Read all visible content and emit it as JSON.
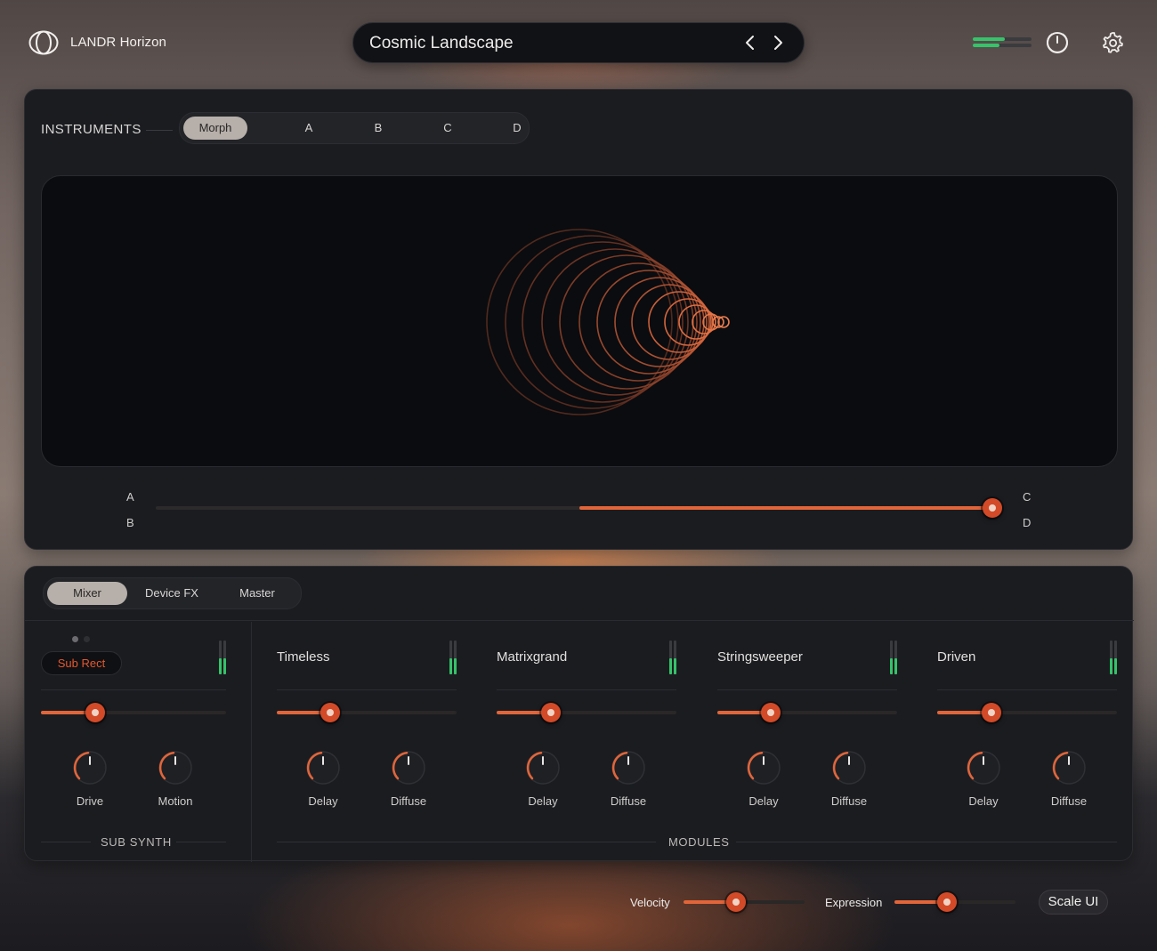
{
  "app": {
    "name": "LANDR Horizon"
  },
  "preset": {
    "name": "Cosmic Landscape"
  },
  "instruments": {
    "label": "INSTRUMENTS",
    "tabs": [
      "Morph",
      "A",
      "B",
      "C",
      "D"
    ],
    "active_tab": "Morph"
  },
  "morph": {
    "corner_labels": {
      "top_left": "A",
      "bottom_left": "B",
      "top_right": "C",
      "bottom_right": "D"
    },
    "position": 1.0
  },
  "mixer_tabs": {
    "items": [
      "Mixer",
      "Device FX",
      "Master"
    ],
    "active": "Mixer"
  },
  "sub_synth": {
    "source_label": "Sub Rect",
    "level": 0.29,
    "knobs": [
      {
        "label": "Drive",
        "value": 0.4
      },
      {
        "label": "Motion",
        "value": 0.45
      }
    ],
    "section_label": "SUB SYNTH"
  },
  "modules": {
    "section_label": "MODULES",
    "channels": [
      {
        "name": "Timeless",
        "level": 0.29,
        "knobs": [
          {
            "label": "Delay",
            "value": 0.4
          },
          {
            "label": "Diffuse",
            "value": 0.45
          }
        ]
      },
      {
        "name": "Matrixgrand",
        "level": 0.29,
        "knobs": [
          {
            "label": "Delay",
            "value": 0.4
          },
          {
            "label": "Diffuse",
            "value": 0.45
          }
        ]
      },
      {
        "name": "Stringsweeper",
        "level": 0.29,
        "knobs": [
          {
            "label": "Delay",
            "value": 0.4
          },
          {
            "label": "Diffuse",
            "value": 0.45
          }
        ]
      },
      {
        "name": "Driven",
        "level": 0.29,
        "knobs": [
          {
            "label": "Delay",
            "value": 0.4
          },
          {
            "label": "Diffuse",
            "value": 0.45
          }
        ]
      }
    ]
  },
  "footer": {
    "velocity": {
      "label": "Velocity",
      "value": 0.44
    },
    "expression": {
      "label": "Expression",
      "value": 0.44
    },
    "scale_button": "Scale UI"
  },
  "colors": {
    "accent": "#e2653a",
    "thumb": "#d24a28",
    "meter_green": "#35c46a",
    "panel": "#1b1c20",
    "viz_bg": "#0b0c0f"
  },
  "icons": [
    "logo-icon",
    "chevron-left-icon",
    "chevron-right-icon",
    "level-meter-icon",
    "power-icon",
    "gear-icon",
    "morph-rings-icon"
  ]
}
